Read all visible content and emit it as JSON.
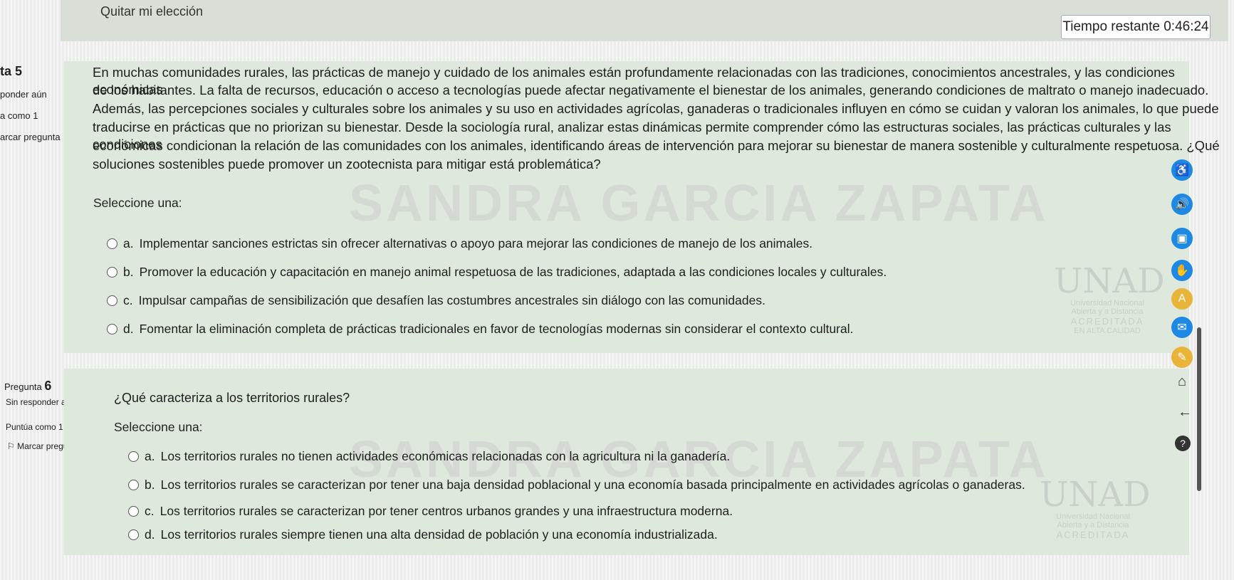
{
  "header": {
    "remove_choice": "Quitar mi elección",
    "timer_label": "Tiempo restante",
    "timer_value": "0:46:24"
  },
  "q5": {
    "info_number": "ta 5",
    "info_status": "ponder aún",
    "info_score": "a como 1",
    "info_flag": "arcar pregunta",
    "text": "En muchas comunidades rurales, las prácticas de manejo y cuidado de los animales están profundamente relacionadas con las tradiciones, conocimientos ancestrales, y las condiciones económicas de los habitantes. La falta de recursos, educación o acceso a tecnologías puede afectar negativamente el bienestar de los animales, generando condiciones de maltrato o manejo inadecuado. Además, las percepciones sociales y culturales sobre los animales y su uso en actividades agrícolas, ganaderas o tradicionales influyen en cómo se cuidan y valoran los animales, lo que puede traducirse en prácticas que no priorizan su bienestar. Desde la sociología rural, analizar estas dinámicas permite comprender cómo las estructuras sociales, las prácticas culturales y las condiciones económicas condicionan la relación de las comunidades con los animales, identificando áreas de intervención para mejorar su bienestar de manera sostenible y culturalmente respetuosa. ¿Qué soluciones sostenibles puede promover un zootecnista para mitigar está problemática?",
    "text_lines": [
      "En muchas comunidades rurales, las prácticas de manejo y cuidado de los animales están profundamente relacionadas con las tradiciones, conocimientos ancestrales, y las condiciones económicas",
      "de los habitantes. La falta de recursos, educación o acceso a tecnologías puede afectar negativamente el bienestar de los animales, generando condiciones de maltrato o manejo inadecuado.",
      "Además, las percepciones sociales y culturales sobre los animales y su uso en actividades agrícolas, ganaderas o tradicionales influyen en cómo se cuidan y valoran los animales, lo que puede",
      "traducirse en prácticas que no priorizan su bienestar. Desde la sociología rural, analizar estas dinámicas permite comprender cómo las estructuras sociales, las prácticas culturales y las condiciones",
      "económicas condicionan la relación de las comunidades con los animales, identificando áreas de intervención para mejorar su bienestar de manera sostenible y culturalmente respetuosa. ¿Qué",
      "soluciones sostenibles puede promover un zootecnista para mitigar está problemática?"
    ],
    "select_label": "Seleccione una:",
    "options": [
      {
        "letter": "a.",
        "text": "Implementar sanciones estrictas sin ofrecer alternativas o apoyo para mejorar las condiciones de manejo de los animales."
      },
      {
        "letter": "b.",
        "text": "Promover la educación y capacitación en manejo animal respetuosa de las tradiciones, adaptada a las condiciones locales y culturales."
      },
      {
        "letter": "c.",
        "text": "Impulsar campañas de sensibilización que desafíen las costumbres ancestrales sin diálogo con las comunidades."
      },
      {
        "letter": "d.",
        "text": "Fomentar la eliminación completa de prácticas tradicionales en favor de tecnologías modernas sin considerar el contexto cultural."
      }
    ]
  },
  "q6": {
    "info_label": "Pregunta",
    "info_number": "6",
    "info_status": "Sin responder aún",
    "info_score": "Puntúa como 1",
    "info_flag": "Marcar pregunta",
    "text": "¿Qué caracteriza a los territorios rurales?",
    "select_label": "Seleccione una:",
    "options": [
      {
        "letter": "a.",
        "text": "Los territorios rurales no tienen actividades económicas relacionadas con la agricultura ni la ganadería."
      },
      {
        "letter": "b.",
        "text": "Los territorios rurales se caracterizan por tener una baja densidad poblacional y una economía basada principalmente en actividades agrícolas o ganaderas."
      },
      {
        "letter": "c.",
        "text": "Los territorios rurales se caracterizan por tener centros urbanos grandes y una infraestructura moderna."
      },
      {
        "letter": "d.",
        "text": "Los territorios rurales siempre tienen una alta densidad de población y una economía industrializada."
      }
    ]
  },
  "watermark": {
    "q5_text": "SANDRA GARCIA ZAPATA",
    "q6_text": "SANDRA GARCIA ZAPATA",
    "logo_letters": "UNAD",
    "logo_sub1": "Universidad Nacional",
    "logo_sub2": "Abierta y a Distancia",
    "logo_acc1": "ACREDITADA",
    "logo_acc2": "EN ALTA CALIDAD"
  },
  "side_icons": [
    {
      "name": "accessibility-icon",
      "glyph": "♿",
      "color": "#1e88e5"
    },
    {
      "name": "speaker-icon",
      "glyph": "🔊",
      "color": "#1e88e5"
    },
    {
      "name": "image-icon",
      "glyph": "▣",
      "color": "#1e88e5"
    },
    {
      "name": "hand-icon",
      "glyph": "✋",
      "color": "#1e88e5"
    },
    {
      "name": "font-icon",
      "glyph": "A",
      "color": "#e9b43a"
    },
    {
      "name": "mail-icon",
      "glyph": "✉",
      "color": "#1e88e5"
    },
    {
      "name": "note-icon",
      "glyph": "✎",
      "color": "#e9b43a"
    }
  ],
  "colors": {
    "accent_blue": "#1e88e5",
    "accent_yellow": "#e9b43a",
    "panel_green": "#dfe8dd"
  }
}
